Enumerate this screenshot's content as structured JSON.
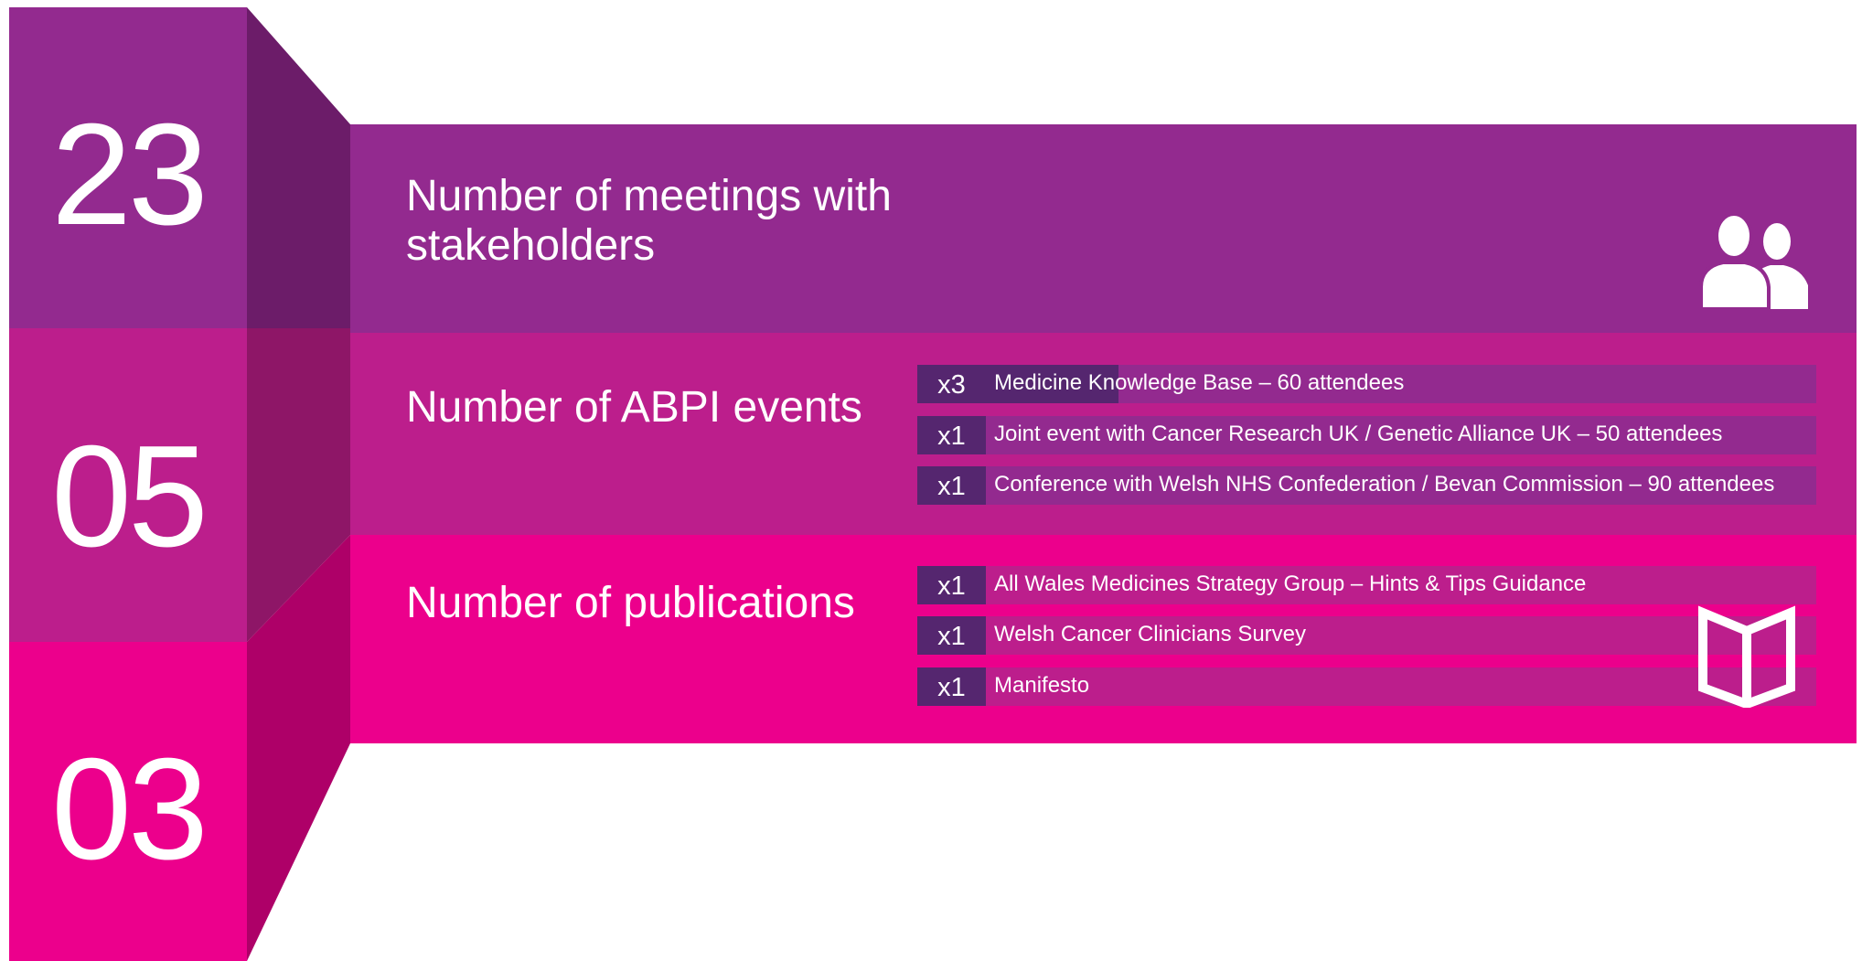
{
  "colors": {
    "purple": "#932a8f",
    "purple_dark": "#6c1c69",
    "magenta": "#bc1e8c",
    "magenta_dark": "#8e1667",
    "pink": "#ec008c",
    "pink_dark": "#ae0068",
    "count_box": "#55266f",
    "text": "#ffffff"
  },
  "stats": [
    {
      "number": "23",
      "title": "Number of meetings with\nstakeholders",
      "icon": "people-icon",
      "items": []
    },
    {
      "number": "05",
      "title": "Number of ABPI events",
      "icon": "",
      "items": [
        {
          "count": "x3",
          "label": "Medicine Knowledge Base – 60 attendees"
        },
        {
          "count": "x1",
          "label": "Joint event with Cancer Research UK / Genetic Alliance UK – 50 attendees"
        },
        {
          "count": "x1",
          "label": "Conference with Welsh NHS Confederation / Bevan Commission – 90 attendees"
        }
      ]
    },
    {
      "number": "03",
      "title": "Number of publications",
      "icon": "open-book-icon",
      "items": [
        {
          "count": "x1",
          "label": "All Wales Medicines Strategy Group – Hints & Tips Guidance"
        },
        {
          "count": "x1",
          "label": "Welsh Cancer Clinicians Survey"
        },
        {
          "count": "x1",
          "label": "Manifesto"
        }
      ]
    }
  ]
}
